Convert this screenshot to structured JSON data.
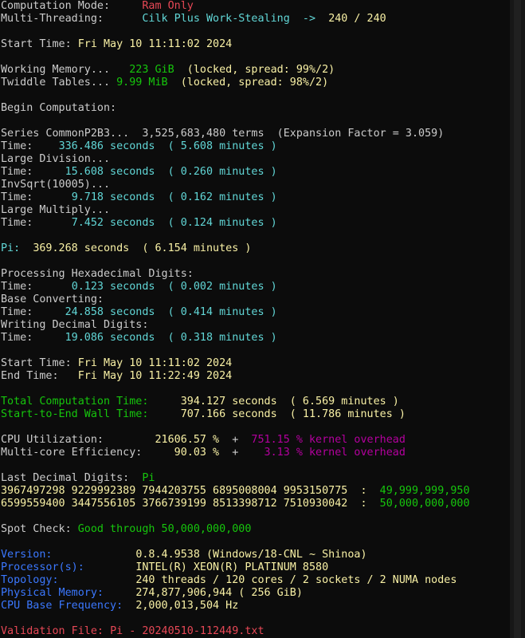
{
  "colors": {
    "white": "#cccccc",
    "red": "#e74856",
    "teal": "#61d6d6",
    "yellow": "#f9f1a5",
    "green": "#16c60c",
    "blue": "#3b78ff",
    "magenta": "#b4009e",
    "background": "#0c0c0c"
  },
  "lines": [
    [
      [
        "Computation Mode:     ",
        "white"
      ],
      [
        "Ram Only",
        "red"
      ]
    ],
    [
      [
        "Multi-Threading:      ",
        "white"
      ],
      [
        "Cilk Plus Work-Stealing",
        "teal"
      ],
      [
        "  ->  ",
        "teal"
      ],
      [
        "240 / 240",
        "yellow"
      ]
    ],
    [],
    [
      [
        "Start Time: ",
        "white"
      ],
      [
        "Fri May 10 11:11:02 2024",
        "yellow"
      ]
    ],
    [],
    [
      [
        "Working Memory...   ",
        "white"
      ],
      [
        "223 GiB",
        "green"
      ],
      [
        "  (locked, spread: 99%/2)",
        "yellow"
      ]
    ],
    [
      [
        "Twiddle Tables... ",
        "white"
      ],
      [
        "9.99 MiB",
        "green"
      ],
      [
        "  (locked, spread: 98%/2)",
        "yellow"
      ]
    ],
    [],
    [
      [
        "Begin Computation:",
        "white"
      ]
    ],
    [],
    [
      [
        "Series CommonP2B3...  3,525,683,480 terms  (Expansion Factor = 3.059)",
        "white"
      ]
    ],
    [
      [
        "Time:    ",
        "white"
      ],
      [
        "336.486 seconds  ( 5.608 minutes )",
        "teal"
      ]
    ],
    [
      [
        "Large Division...",
        "white"
      ]
    ],
    [
      [
        "Time:     ",
        "white"
      ],
      [
        "15.608 seconds  ( 0.260 minutes )",
        "teal"
      ]
    ],
    [
      [
        "InvSqrt(10005)...",
        "white"
      ]
    ],
    [
      [
        "Time:      ",
        "white"
      ],
      [
        "9.718 seconds  ( 0.162 minutes )",
        "teal"
      ]
    ],
    [
      [
        "Large Multiply...",
        "white"
      ]
    ],
    [
      [
        "Time:      ",
        "white"
      ],
      [
        "7.452 seconds  ( 0.124 minutes )",
        "teal"
      ]
    ],
    [],
    [
      [
        "Pi:  ",
        "teal"
      ],
      [
        "369.268 seconds  ( 6.154 minutes )",
        "yellow"
      ]
    ],
    [],
    [
      [
        "Processing Hexadecimal Digits:",
        "white"
      ]
    ],
    [
      [
        "Time:      ",
        "white"
      ],
      [
        "0.123 seconds  ( 0.002 minutes )",
        "teal"
      ]
    ],
    [
      [
        "Base Converting:",
        "white"
      ]
    ],
    [
      [
        "Time:     ",
        "white"
      ],
      [
        "24.858 seconds  ( 0.414 minutes )",
        "teal"
      ]
    ],
    [
      [
        "Writing Decimal Digits:",
        "white"
      ]
    ],
    [
      [
        "Time:     ",
        "white"
      ],
      [
        "19.086 seconds  ( 0.318 minutes )",
        "teal"
      ]
    ],
    [],
    [
      [
        "Start Time: ",
        "white"
      ],
      [
        "Fri May 10 11:11:02 2024",
        "yellow"
      ]
    ],
    [
      [
        "End Time:   ",
        "white"
      ],
      [
        "Fri May 10 11:22:49 2024",
        "yellow"
      ]
    ],
    [],
    [
      [
        "Total Computation Time:     ",
        "green"
      ],
      [
        "394.127 seconds  ( 6.569 minutes )",
        "yellow"
      ]
    ],
    [
      [
        "Start-to-End Wall Time:     ",
        "green"
      ],
      [
        "707.166 seconds  ( 11.786 minutes )",
        "yellow"
      ]
    ],
    [],
    [
      [
        "CPU Utilization:        ",
        "white"
      ],
      [
        "21606.57 %",
        "yellow"
      ],
      [
        "  +  ",
        "white"
      ],
      [
        "751.15 % kernel overhead",
        "magenta"
      ]
    ],
    [
      [
        "Multi-core Efficiency:     ",
        "white"
      ],
      [
        "90.03 %",
        "yellow"
      ],
      [
        "  +    ",
        "white"
      ],
      [
        "3.13 % kernel overhead",
        "magenta"
      ]
    ],
    [],
    [
      [
        "Last Decimal Digits:  ",
        "white"
      ],
      [
        "Pi",
        "green"
      ]
    ],
    [
      [
        "3967497298 9229992389 7944203755 6895008004 9953150775  :  ",
        "yellow"
      ],
      [
        "49,999,999,950",
        "green"
      ]
    ],
    [
      [
        "6599559400 3447556105 3766739199 8513398712 7510930042  :  ",
        "yellow"
      ],
      [
        "50,000,000,000",
        "green"
      ]
    ],
    [],
    [
      [
        "Spot Check: ",
        "white"
      ],
      [
        "Good through 50,000,000,000",
        "green"
      ]
    ],
    [],
    [
      [
        "Version:             ",
        "blue"
      ],
      [
        "0.8.4.9538 (Windows/18-CNL ~ Shinoa)",
        "yellow"
      ]
    ],
    [
      [
        "Processor(s):        ",
        "blue"
      ],
      [
        "INTEL(R) XEON(R) PLATINUM 8580",
        "yellow"
      ]
    ],
    [
      [
        "Topology:            ",
        "blue"
      ],
      [
        "240 threads / 120 cores / 2 sockets / 2 NUMA nodes",
        "yellow"
      ]
    ],
    [
      [
        "Physical Memory:     ",
        "blue"
      ],
      [
        "274,877,906,944 ( 256 GiB)",
        "yellow"
      ]
    ],
    [
      [
        "CPU Base Frequency:  ",
        "blue"
      ],
      [
        "2,000,013,504 Hz",
        "yellow"
      ]
    ],
    [],
    [
      [
        "Validation File: ",
        "red"
      ],
      [
        "Pi - 20240510-112449.txt",
        "red"
      ]
    ]
  ]
}
